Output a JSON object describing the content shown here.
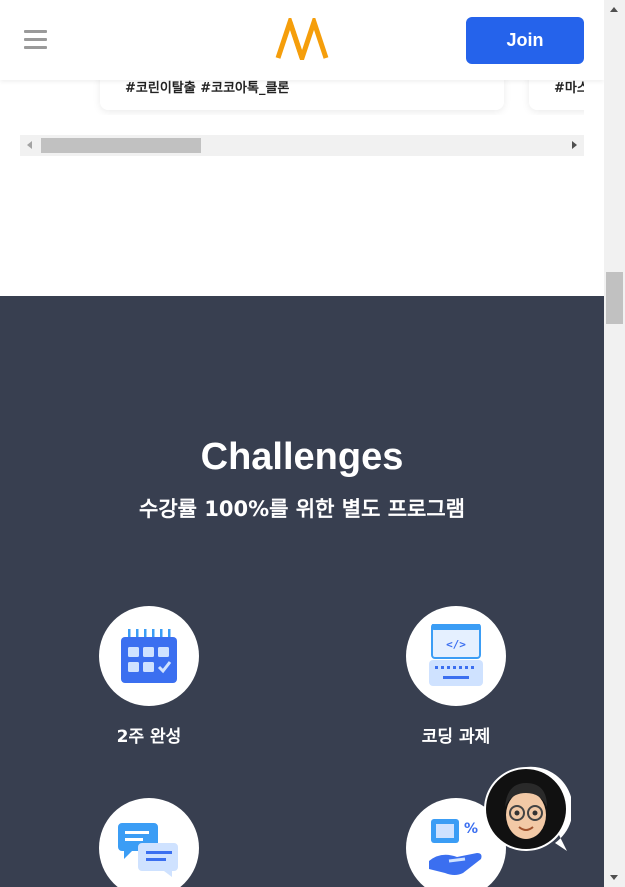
{
  "header": {
    "menu_icon": "hamburger-menu-icon",
    "logo_icon": "nomad-logo-icon",
    "join_label": "Join"
  },
  "cards": [
    {
      "tags": "#코린이탈출 #코코아톡_클론"
    },
    {
      "tags": "#마스"
    }
  ],
  "challenges": {
    "title": "Challenges",
    "subtitle": "수강률 100%를 위한 별도 프로그램",
    "features": [
      {
        "label": "2주 완성",
        "icon": "calendar-icon"
      },
      {
        "label": "코딩 과제",
        "icon": "code-keyboard-icon"
      },
      {
        "label": "",
        "icon": "chat-bubbles-icon"
      },
      {
        "label": "",
        "icon": "discount-hand-icon"
      }
    ]
  },
  "colors": {
    "accent": "#2563eb",
    "dark_section": "#383f50",
    "logo": "#f59e0b"
  }
}
